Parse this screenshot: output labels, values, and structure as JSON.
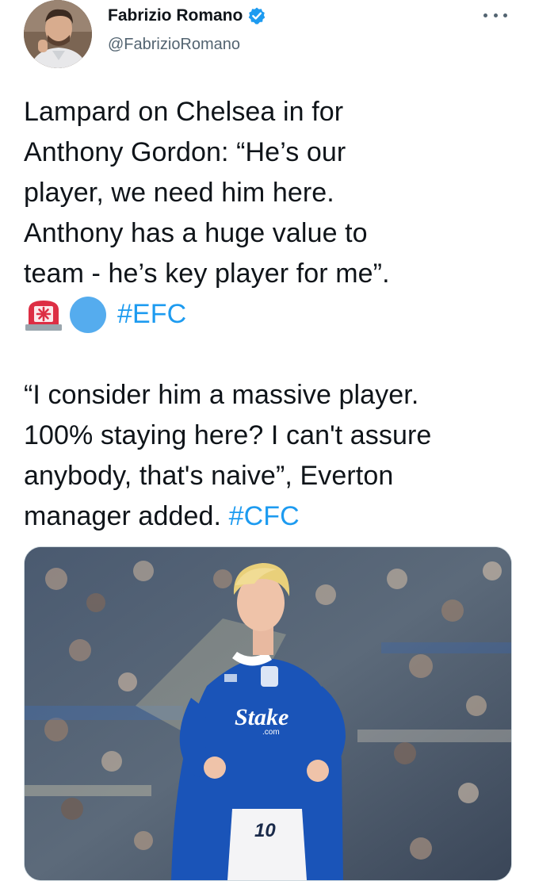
{
  "author": {
    "display_name": "Fabrizio Romano",
    "handle": "@FabrizioRomano",
    "verified": true,
    "verified_color": "#1d9bf0"
  },
  "tweet": {
    "paragraph1": "Lampard on Chelsea in for\nAnthony Gordon: “He’s our\nplayer, we need him here.\nAnthony has a huge value to\nteam - he’s key player for me”.",
    "emoji_line": {
      "emojis": [
        "police-car-light-emoji",
        "blue-circle-emoji"
      ],
      "hashtag": "#EFC"
    },
    "paragraph2": "“I consider him a massive player.\n100% staying here? I can't assure\nanybody, that's naive”, Everton\nmanager added. ",
    "paragraph2_hashtag": "#CFC",
    "hashtag_color": "#1d9bf0"
  },
  "media": {
    "kind": "photo",
    "shirt_sponsor": "Stake",
    "shirt_sponsor_sub": ".com",
    "shirt_number": "10"
  },
  "icons": {
    "more": "more-horizontal-icon",
    "verified": "verified-badge-icon"
  }
}
